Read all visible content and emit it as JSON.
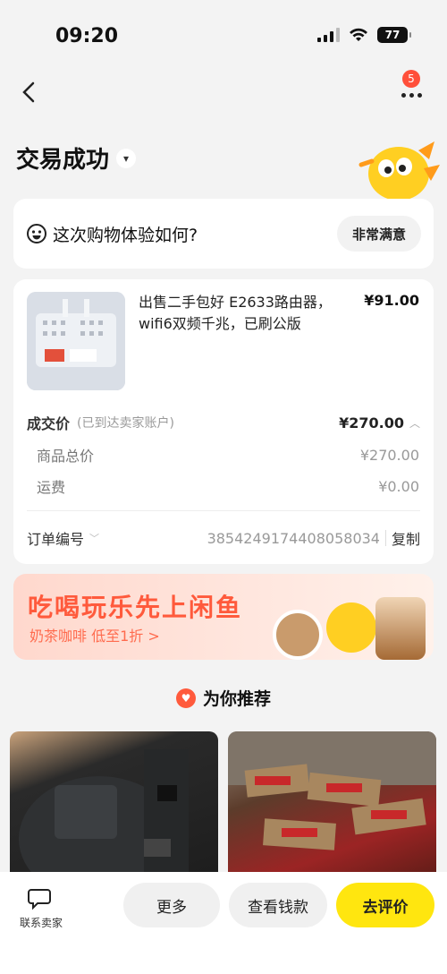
{
  "status_bar": {
    "time": "09:20",
    "battery": "77"
  },
  "nav": {
    "badge_count": "5"
  },
  "page": {
    "title": "交易成功"
  },
  "feedback": {
    "question": "这次购物体验如何?",
    "button": "非常满意"
  },
  "product": {
    "title": "出售二手包好 E2633路由器，wifi6双频千兆，已刷公版",
    "price": "¥91.00"
  },
  "deal": {
    "label": "成交价",
    "sublabel": "(已到达卖家账户)",
    "price": "¥270.00",
    "goods_total_label": "商品总价",
    "goods_total": "¥270.00",
    "shipping_label": "运费",
    "shipping": "¥0.00"
  },
  "order": {
    "label": "订单编号",
    "number": "3854249174408058034",
    "copy": "复制"
  },
  "banner": {
    "title": "吃喝玩乐先上闲鱼",
    "subtitle": "奶茶咖啡 低至1折 >"
  },
  "recommend": {
    "title": "为你推荐"
  },
  "bottom": {
    "contact": "联系卖家",
    "more": "更多",
    "view_money": "查看钱款",
    "review": "去评价"
  },
  "colors": {
    "accent_yellow": "#ffe60f",
    "accent_orange": "#ff5a3c"
  }
}
